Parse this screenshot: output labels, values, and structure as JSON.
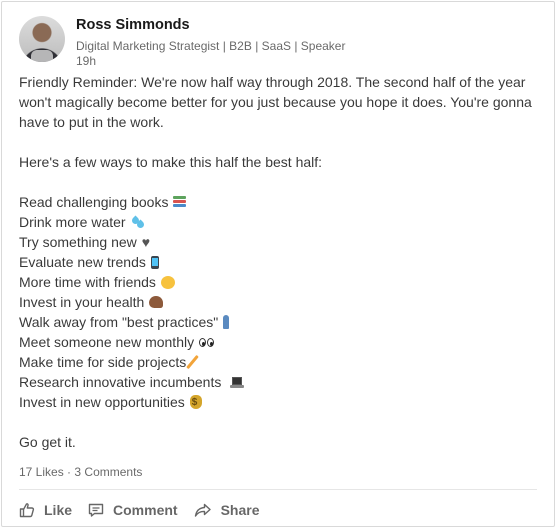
{
  "post": {
    "author": {
      "name": "Ross Simmonds",
      "headline": "Digital Marketing Strategist | B2B | SaaS | Speaker",
      "time": "19h"
    },
    "paragraphs": [
      "Friendly Reminder: We're now half way through 2018. The second half of the year won't magically become better for you just because you hope it does. You're gonna have to put in the work.",
      "Here's a few ways to make this half the best half:"
    ],
    "list": [
      {
        "text": "Read challenging books",
        "icon": "books-icon"
      },
      {
        "text": "Drink more water",
        "icon": "water-drops-icon"
      },
      {
        "text": "Try something new",
        "icon": "heart-icon"
      },
      {
        "text": "Evaluate new trends",
        "icon": "phone-icon"
      },
      {
        "text": "More time with friends",
        "icon": "hugging-face-icon"
      },
      {
        "text": "Invest in your health",
        "icon": "flexed-biceps-icon"
      },
      {
        "text": "Walk away from \"best practices\"",
        "icon": "walking-person-icon"
      },
      {
        "text": "Meet someone new monthly",
        "icon": "eyes-icon"
      },
      {
        "text": "Make time for side projects",
        "icon": "pencil-icon"
      },
      {
        "text": "Research innovative incumbents",
        "icon": "laptop-icon"
      },
      {
        "text": "Invest in new opportunities",
        "icon": "money-bag-icon"
      }
    ],
    "closing": "Go get it.",
    "likes": "17 Likes",
    "separator": "·",
    "comments": "3 Comments"
  },
  "actions": {
    "like": "Like",
    "comment": "Comment",
    "share": "Share"
  }
}
